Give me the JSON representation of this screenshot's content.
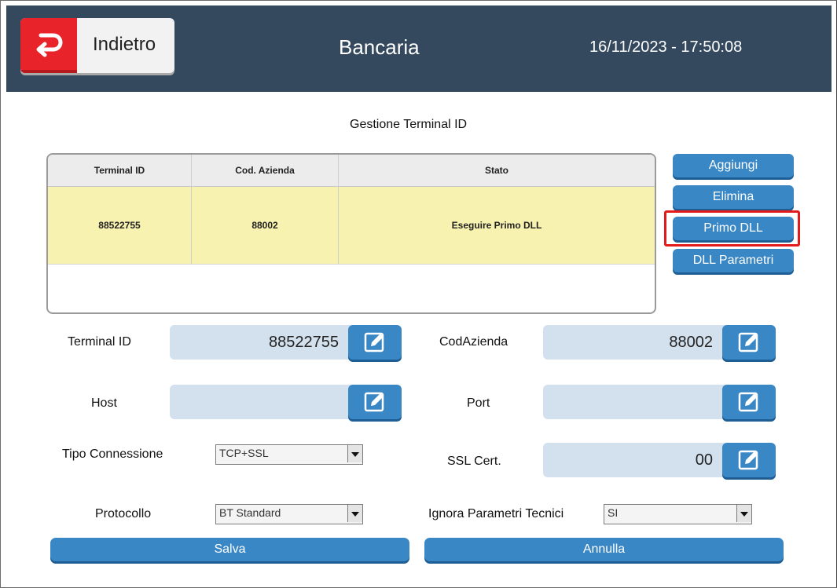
{
  "header": {
    "back_label": "Indietro",
    "title": "Bancaria",
    "datetime": "16/11/2023 - 17:50:08"
  },
  "section_title": "Gestione Terminal ID",
  "table": {
    "columns": [
      "Terminal ID",
      "Cod. Azienda",
      "Stato"
    ],
    "rows": [
      [
        "88522755",
        "88002",
        "Eseguire Primo DLL"
      ]
    ]
  },
  "actions": {
    "add": "Aggiungi",
    "delete": "Elimina",
    "first_dll": "Primo DLL",
    "dll_params": "DLL Parametri"
  },
  "form": {
    "terminal_id": {
      "label": "Terminal ID",
      "value": "88522755"
    },
    "cod_azienda": {
      "label": "CodAzienda",
      "value": "88002"
    },
    "host": {
      "label": "Host",
      "value": ""
    },
    "port": {
      "label": "Port",
      "value": ""
    },
    "tipo_connessione": {
      "label": "Tipo Connessione",
      "value": "TCP+SSL"
    },
    "ssl_cert": {
      "label": "SSL Cert.",
      "value": "00"
    },
    "protocollo": {
      "label": "Protocollo",
      "value": "BT Standard"
    },
    "ignora_parametri": {
      "label": "Ignora Parametri Tecnici",
      "value": "SI"
    }
  },
  "buttons": {
    "save": "Salva",
    "cancel": "Annulla"
  },
  "colors": {
    "header_bg": "#34495e",
    "accent_blue": "#3a87c6",
    "back_red": "#e8232a",
    "selected_row": "#f8f2b0",
    "highlight_red": "#e31b1b",
    "field_bg": "#d3e1ee"
  }
}
